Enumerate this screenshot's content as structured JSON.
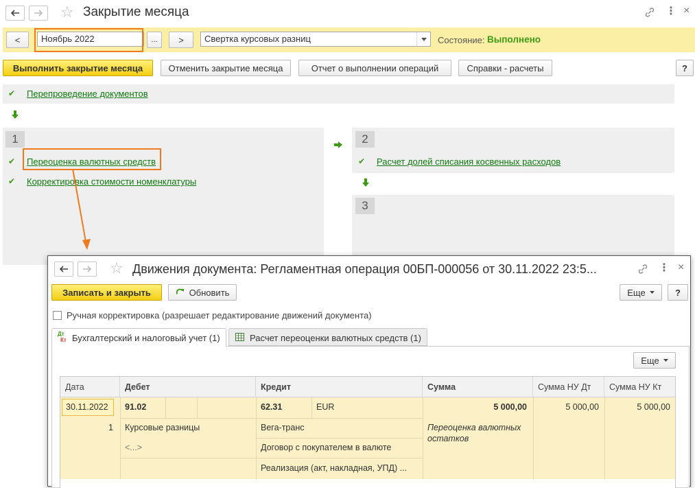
{
  "main": {
    "title": "Закрытие месяца",
    "period_value": "Ноябрь 2022",
    "period_prev": "<",
    "period_next": ">",
    "period_choose": "...",
    "mode_value": "Свертка курсовых разниц",
    "status_label": "Состояние:",
    "status_value": "Выполнено",
    "buttons": {
      "execute": "Выполнить закрытие месяца",
      "cancel": "Отменить закрытие месяца",
      "report": "Отчет о выполнении операций",
      "help_calc": "Справки - расчеты",
      "help": "?"
    },
    "step0_link": "Перепроведение документов",
    "step1_num": "1",
    "step1_items": [
      "Переоценка валютных средств",
      "Корректировка стоимости номенклатуры"
    ],
    "step2_num": "2",
    "step2_items": [
      "Расчет долей списания косвенных расходов"
    ],
    "step3_num": "3"
  },
  "dialog": {
    "title": "Движения документа: Регламентная операция 00БП-000056 от 30.11.2022 23:5...",
    "save_close": "Записать и закрыть",
    "refresh": "Обновить",
    "more": "Еще",
    "help": "?",
    "manual_label": "Ручная корректировка (разрешает редактирование движений документа)",
    "tabs": [
      {
        "label": "Бухгалтерский и налоговый учет (1)",
        "icon": "dt-kt-icon"
      },
      {
        "label": "Расчет переоценки валютных средств (1)",
        "icon": "table-icon"
      }
    ],
    "dtkt_dt": "Дт",
    "dtkt_kt": "Кт",
    "table_more": "Еще",
    "columns": [
      "Дата",
      "Дебет",
      "Кредит",
      "Сумма",
      "Сумма НУ Дт",
      "Сумма НУ Кт"
    ],
    "row": {
      "date": "30.11.2022",
      "num": "1",
      "debit_account": "91.02",
      "debit_sub1": "Курсовые разницы",
      "debit_sub2": "<...>",
      "credit_account": "62.31",
      "credit_currency": "EUR",
      "credit_sub1": "Вега-транс",
      "credit_sub2": "Договор с покупателем в валюте",
      "credit_sub3": "Реализация (акт, накладная, УПД) ...",
      "amount": "5 000,00",
      "content": "Переоценка валютных остатков",
      "nu_dt": "5 000,00",
      "nu_kt": "5 000,00"
    }
  },
  "colors": {
    "accent_yellow": "#f4cf14",
    "toolbar_bg": "#fbeea5",
    "link_green": "#0e7a0e",
    "highlight_orange": "#f07b1f",
    "status_green": "#3c9a14"
  }
}
